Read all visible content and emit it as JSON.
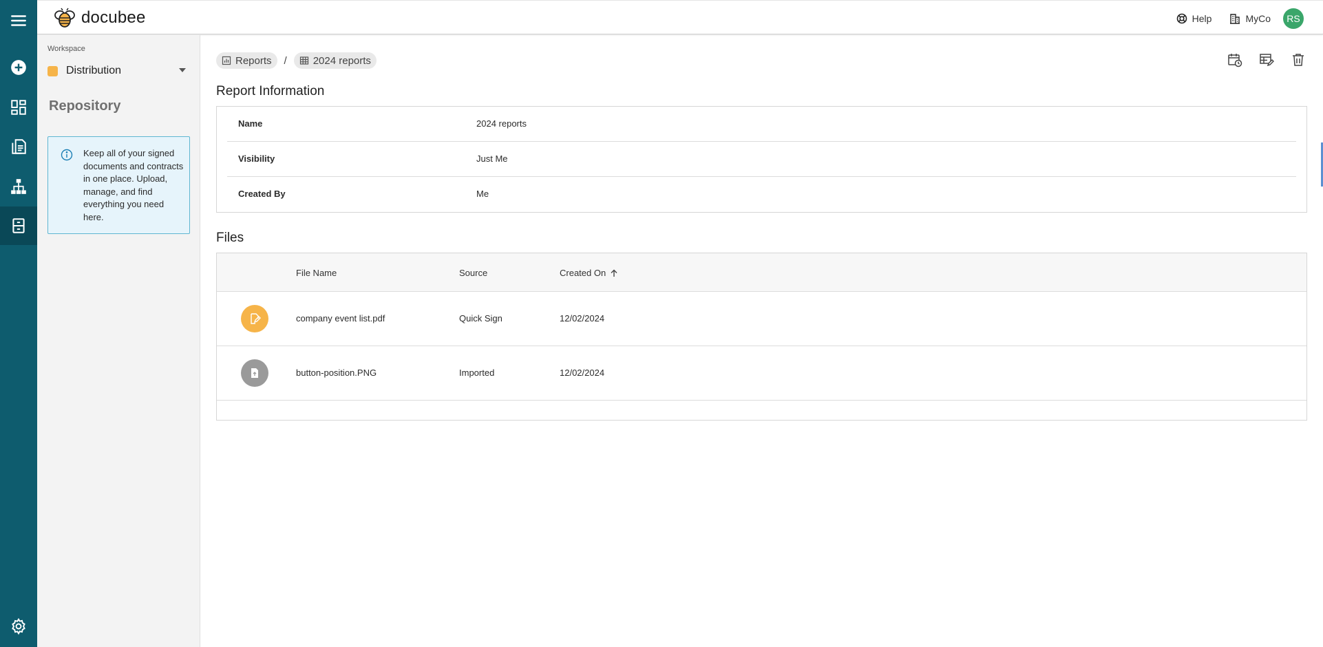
{
  "app": {
    "name": "docubee"
  },
  "header": {
    "help_label": "Help",
    "org_label": "MyCo",
    "avatar_initials": "RS",
    "avatar_color": "#3aa66a"
  },
  "rail": {
    "color": "#0e5c6e",
    "items": [
      {
        "icon": "hamburger-menu-icon"
      },
      {
        "icon": "add-circle-icon"
      },
      {
        "icon": "dashboard-icon"
      },
      {
        "icon": "documents-icon"
      },
      {
        "icon": "workflow-icon"
      },
      {
        "icon": "repository-icon",
        "active": true
      },
      {
        "icon": "settings-gear-icon"
      }
    ]
  },
  "sidebar": {
    "workspace_label": "Workspace",
    "workspace_name": "Distribution",
    "workspace_color": "#f6b449",
    "section_title": "Repository",
    "info_text": "Keep all of your signed documents and contracts in one place. Upload, manage, and find everything you need here."
  },
  "breadcrumb": [
    {
      "label": "Reports",
      "icon": "report-chart-icon"
    },
    {
      "label": "2024 reports",
      "icon": "table-grid-icon"
    }
  ],
  "breadcrumb_separator": "/",
  "actions": [
    {
      "icon": "schedule-calendar-icon"
    },
    {
      "icon": "edit-report-icon"
    },
    {
      "icon": "delete-trash-icon"
    }
  ],
  "report_info": {
    "title": "Report Information",
    "rows": [
      {
        "key": "Name",
        "value": "2024 reports"
      },
      {
        "key": "Visibility",
        "value": "Just Me"
      },
      {
        "key": "Created By",
        "value": "Me"
      }
    ]
  },
  "files": {
    "title": "Files",
    "columns": {
      "name": "File Name",
      "source": "Source",
      "created": "Created On"
    },
    "sort": {
      "column": "Created On",
      "direction": "ascending"
    },
    "rows": [
      {
        "name": "company event list.pdf",
        "source": "Quick Sign",
        "created": "12/02/2024",
        "icon": "signed-document-icon",
        "icon_color": "#f6b449"
      },
      {
        "name": "button-position.PNG",
        "source": "Imported",
        "created": "12/02/2024",
        "icon": "imported-file-icon",
        "icon_color": "#9a9a9a"
      }
    ]
  }
}
